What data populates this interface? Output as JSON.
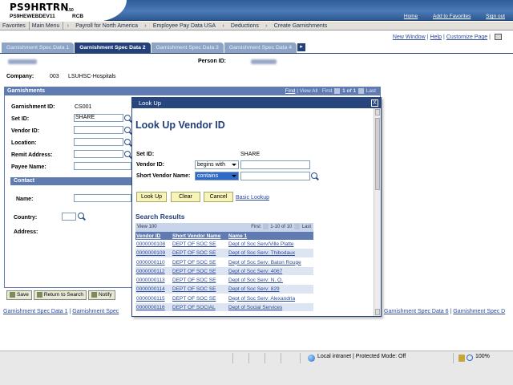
{
  "header": {
    "app_title": "PS9HRTRN",
    "version": "8.50",
    "db_name": "PS9HEWEBDEV11",
    "user": "RCB",
    "links": [
      "Home",
      "Add to Favorites",
      "Sign out"
    ]
  },
  "menubar": {
    "items": [
      "Favorites",
      "Main Menu"
    ],
    "breadcrumbs": [
      "Payroll for North America",
      "Employee Pay Data USA",
      "Deductions",
      "Create Garnishments"
    ]
  },
  "page_links": [
    "New Window",
    "Help",
    "Customize Page"
  ],
  "tabs": [
    "Garnishment Spec Data 1",
    "Garnishment Spec Data 2",
    "Garnishment Spec Data 3",
    "Garnishment Spec Data 4"
  ],
  "active_tab": 1,
  "form": {
    "person_id_label": "Person ID:",
    "company_label": "Company:",
    "company_code": "003",
    "company_name": "LSUHSC-Hospitals",
    "section_title": "Garnishments",
    "find_label": "Find",
    "view_all_label": "View All",
    "first_label": "First",
    "count_label": "1 of 1",
    "last_label": "Last",
    "garnishment_id_label": "Garnishment ID:",
    "garnishment_id": "CS001",
    "set_id_label": "Set ID:",
    "set_id": "SHARE",
    "vendor_id_label": "Vendor ID:",
    "location_label": "Location:",
    "remit_address_label": "Remit Address:",
    "payee_name_label": "Payee Name:",
    "contact_title": "Contact",
    "name_label": "Name:",
    "country_label": "Country:",
    "address_label": "Address:"
  },
  "bottom_buttons": [
    "Save",
    "Return to Search",
    "Notify"
  ],
  "bottom_links": [
    "Garnishment Spec Data 1",
    "Garnishment Spec"
  ],
  "bottom_links_right": [
    "Garnishment Spec Data 6",
    "Garnishment Spec D"
  ],
  "modal": {
    "title": "Look Up",
    "close": "X",
    "heading": "Look Up Vendor ID",
    "set_id_label": "Set ID:",
    "set_id_value": "SHARE",
    "vendor_id_label": "Vendor ID:",
    "vendor_id_op": "begins with",
    "short_vendor_label": "Short Vendor Name:",
    "short_vendor_op": "contains",
    "btn_lookup": "Look Up",
    "btn_clear": "Clear",
    "btn_cancel": "Cancel",
    "basic_lookup": "Basic Lookup",
    "results_title": "Search Results",
    "view_label": "View 100",
    "first_label": "First",
    "range_label": "1-10 of 10",
    "last_label": "Last",
    "columns": [
      "Vendor ID",
      "Short Vendor Name",
      "Name 1"
    ],
    "rows": [
      [
        "0000000108",
        "DEPT OF SOC SE",
        "Dept of Soc Serv/Ville Platte"
      ],
      [
        "0000000109",
        "DEPT OF SOC SE",
        "Dept of Soc Serv: Thibodaux"
      ],
      [
        "0000000110",
        "DEPT OF SOC SE",
        "Dept of Soc Serv: Baton Rouge"
      ],
      [
        "0000000112",
        "DEPT OF SOC SE",
        "Dept of Soc Serv: 4067"
      ],
      [
        "0000000113",
        "DEPT OF SOC SE",
        "Dept of Soc Serv: N. O."
      ],
      [
        "0000000114",
        "DEPT OF SOC SE",
        "Dept of Soc Serv: 829"
      ],
      [
        "0000000115",
        "DEPT OF SOC SE",
        "Dept of Soc Serv: Alexandria"
      ],
      [
        "0000000116",
        "DEPT OF SOCIAL",
        "Dept of Social Services"
      ]
    ]
  },
  "status": {
    "zone": "Local intranet | Protected Mode: Off",
    "zoom": "100%"
  }
}
